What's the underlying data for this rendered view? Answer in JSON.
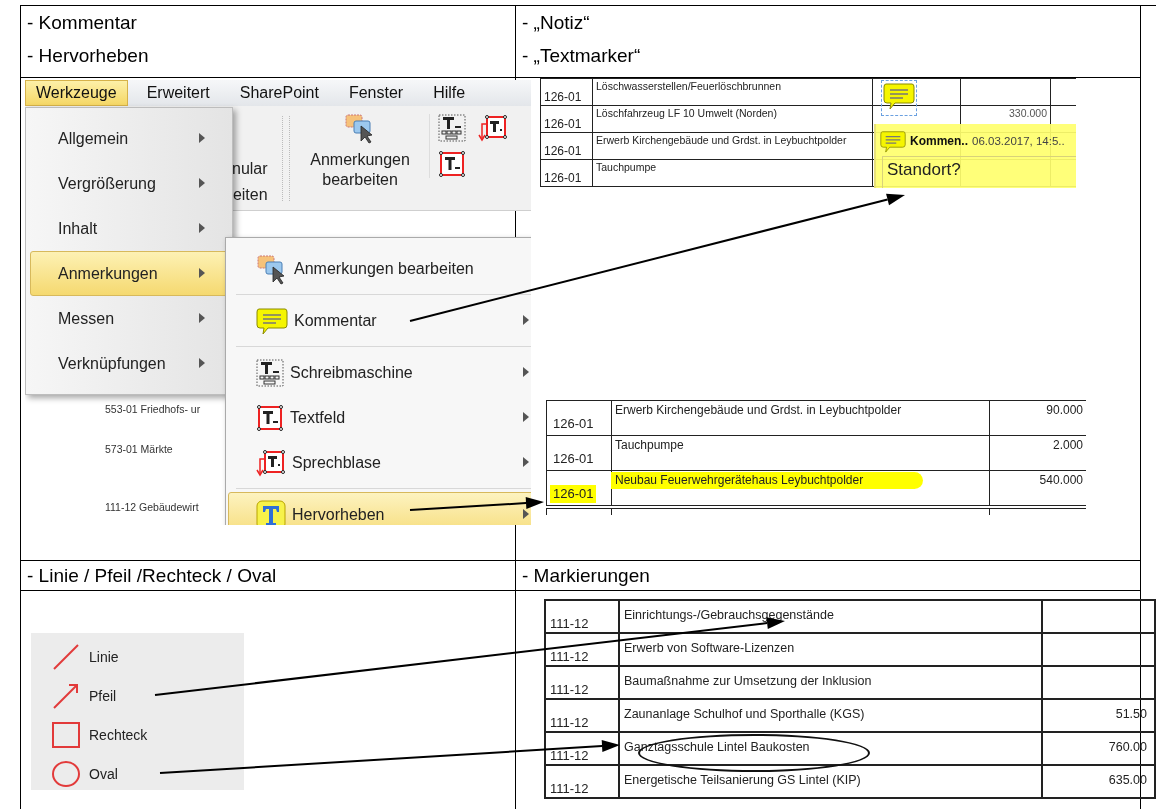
{
  "header_top": {
    "left": [
      "- Kommentar",
      "- Hervorheben"
    ],
    "right": [
      "- „Notiz“",
      "- „Textmarker“"
    ]
  },
  "tools_screenshot": {
    "menubar": [
      {
        "label": "Werkzeuge",
        "selected": true
      },
      {
        "label": "Erweitert",
        "selected": false
      },
      {
        "label": "SharePoint",
        "selected": false
      },
      {
        "label": "Fenster",
        "selected": false
      },
      {
        "label": "Hilfe",
        "selected": false
      }
    ],
    "toolbar": {
      "partial_button": [
        "nular",
        "eiten"
      ],
      "button": "Anmerkungen bearbeiten"
    },
    "document_lines": [
      "553-01 Friedhofs- ur",
      "573-01 Märkte",
      "111-12 Gebäudewirt"
    ],
    "menu": [
      {
        "label": "Allgemein",
        "selected": false
      },
      {
        "label": "Vergrößerung",
        "selected": false
      },
      {
        "label": "Inhalt",
        "selected": false
      },
      {
        "label": "Anmerkungen",
        "selected": true
      },
      {
        "label": "Messen",
        "selected": false
      },
      {
        "label": "Verknüpfungen",
        "selected": false
      }
    ],
    "submenu": [
      {
        "kind": "edit",
        "label": "Anmerkungen bearbeiten",
        "has_arrow": false,
        "selected": false,
        "divider_after": true
      },
      {
        "kind": "comment",
        "label": "Kommentar",
        "has_arrow": true,
        "selected": false,
        "divider_after": true
      },
      {
        "kind": "typewriter",
        "label": "Schreibmaschine",
        "has_arrow": true,
        "selected": false,
        "divider_after": false
      },
      {
        "kind": "textbox",
        "label": "Textfeld",
        "has_arrow": true,
        "selected": false,
        "divider_after": false
      },
      {
        "kind": "callout",
        "label": "Sprechblase",
        "has_arrow": true,
        "selected": false,
        "divider_after": true
      },
      {
        "kind": "highlight",
        "label": "Hervorheben",
        "has_arrow": true,
        "selected": true,
        "divider_after": false
      }
    ]
  },
  "note_screenshot": {
    "rows": [
      {
        "code": "126-01",
        "text": "Löschwasserstellen/Feuerlöschbrunnen"
      },
      {
        "code": "126-01",
        "text": "Löschfahrzeug LF 10 Umwelt (Norden)",
        "amount": "330.000"
      },
      {
        "code": "126-01",
        "text": "Erwerb Kirchengebäude und Grdst. in Leybuchtpolder"
      },
      {
        "code": "126-01",
        "text": "Tauchpumpe"
      }
    ],
    "note": {
      "title": "Kommen..",
      "date": "06.03.2017, 14:5..",
      "text": "Standort?"
    }
  },
  "highlight_screenshot": {
    "rows": [
      {
        "code": "126-01",
        "text": "Erwerb Kirchengebäude und Grdst. in Leybuchtpolder",
        "amount": "90.000",
        "highlighted": false
      },
      {
        "code": "126-01",
        "text": "Tauchpumpe",
        "amount": "2.000",
        "highlighted": false
      },
      {
        "code": "126-01",
        "text": "Neubau Feuerwehrgerätehaus Leybuchtpolder",
        "amount": "540.000",
        "highlighted": true
      }
    ]
  },
  "header_bottom": {
    "left": [
      "- Linie / Pfeil /Rechteck / Oval"
    ],
    "right": [
      "- Markierungen"
    ]
  },
  "shapes_panel": {
    "items": [
      {
        "kind": "line",
        "label": "Linie"
      },
      {
        "kind": "arrow",
        "label": "Pfeil"
      },
      {
        "kind": "rectangle",
        "label": "Rechteck"
      },
      {
        "kind": "oval",
        "label": "Oval"
      }
    ]
  },
  "markings_screenshot": {
    "rows": [
      {
        "code": "111-12",
        "text": "Einrichtungs-/Gebrauchsgegenstände",
        "circled": false
      },
      {
        "code": "111-12",
        "text": "Erwerb von Software-Lizenzen",
        "circled": false
      },
      {
        "code": "111-12",
        "text": "Baumaßnahme zur Umsetzung der Inklusion",
        "circled": false
      },
      {
        "code": "111-12",
        "text": "Zaunanlage Schulhof und Sporthalle (KGS)",
        "amount": "51.50",
        "circled": false
      },
      {
        "code": "111-12",
        "text": "Ganztagsschule Lintel Baukosten",
        "amount": "760.00",
        "circled": true
      },
      {
        "code": "111-12",
        "text": "Energetische Teilsanierung GS Lintel (KIP)",
        "amount": "635.00",
        "circled": false
      }
    ]
  }
}
